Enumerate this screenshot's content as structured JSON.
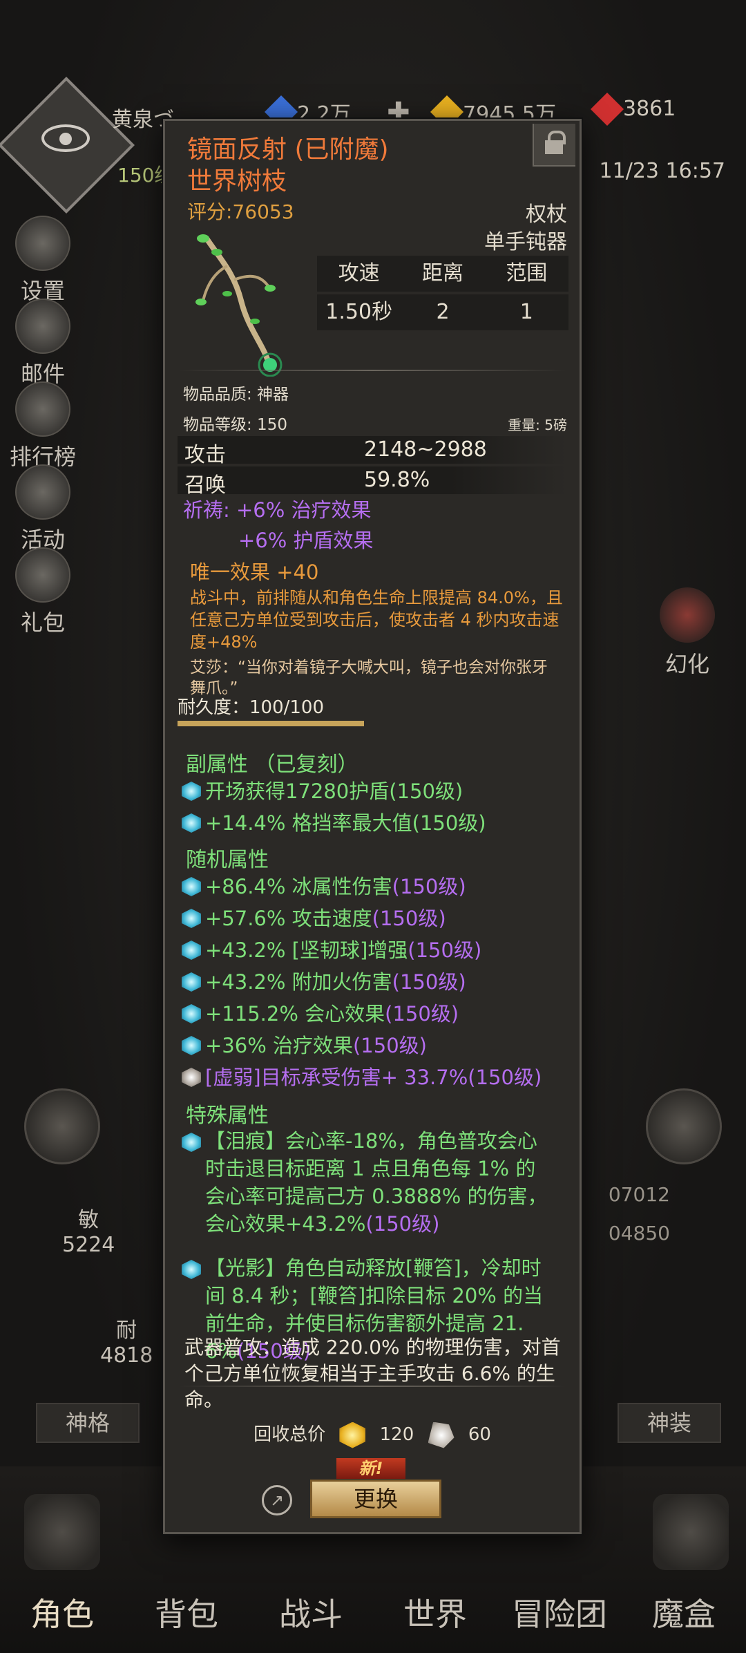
{
  "header": {
    "player_name": "黄泉づ",
    "player_level": "150级",
    "resources": [
      {
        "value": "2.2万",
        "icon": "blue-crystal-icon",
        "color": "#3a6fd8"
      },
      {
        "value": "7945.5万",
        "icon": "gold-crystal-icon",
        "color": "#e8b020"
      },
      {
        "value": "3861",
        "icon": "red-crystal-icon",
        "color": "#d03030"
      }
    ],
    "datetime": "11/23 16:57"
  },
  "sidebar": [
    {
      "label": "设置",
      "icon": "gear-icon"
    },
    {
      "label": "邮件",
      "icon": "mail-icon"
    },
    {
      "label": "排行榜",
      "icon": "ranking-icon"
    },
    {
      "label": "活动",
      "icon": "event-icon"
    },
    {
      "label": "礼包",
      "icon": "gift-icon"
    }
  ],
  "right_panel": {
    "transform_label": "幻化"
  },
  "char_stats": {
    "agi_label": "敏",
    "agi_value": "5224",
    "end_label": "耐",
    "end_value": "4818",
    "right_value_1": "07012",
    "right_value_2": "04850"
  },
  "bottom_chips": {
    "left": "神格",
    "right": "神装"
  },
  "item": {
    "name": "镜面反射 (已附魔)",
    "base_name": "世界树枝",
    "score": "评分:76053",
    "weapon_class": "权杖",
    "weapon_hand": "单手钝器",
    "stat_headers": [
      "攻速",
      "距离",
      "范围"
    ],
    "stat_values": [
      "1.50秒",
      "2",
      "1"
    ],
    "quality": "物品品质: 神器",
    "level": "物品等级: 150",
    "weight": "重量: 5磅",
    "attack_label": "攻击",
    "attack_value": "2148~2988",
    "summon_label": "召唤",
    "summon_value": "59.8%",
    "prayer_1": "祈祷: +6% 治疗效果",
    "prayer_2": "+6% 护盾效果",
    "unique_title": "唯一效果 +40",
    "unique_desc": "战斗中，前排随从和角色生命上限提高 84.0%，且任意己方单位受到攻击后，使攻击者 4 秒内攻击速度+48%",
    "quote": "艾莎：“当你对着镜子大喊大叫，镜子也会对你张牙舞爪。”",
    "durability": "耐久度：100/100",
    "durability_fraction": 1.0,
    "sub_title": "副属性 （已复刻）",
    "sub_attrs": [
      "开场获得17280护盾(150级)",
      "+14.4% 格挡率最大值(150级)"
    ],
    "random_title": "随机属性",
    "random_attrs": [
      {
        "text": "+86.4% 冰属性伤害",
        "lvl": "(150级)"
      },
      {
        "text": "+57.6% 攻击速度",
        "lvl": "(150级)"
      },
      {
        "text": "+43.2% [坚韧球]增强",
        "lvl": "(150级)"
      },
      {
        "text": "+43.2% 附加火伤害",
        "lvl": "(150级)"
      },
      {
        "text": "+115.2% 会心效果",
        "lvl": "(150级)"
      },
      {
        "text": "+36% 治疗效果",
        "lvl": "(150级)"
      },
      {
        "text": "[虚弱]目标承受伤害+ 33.7%",
        "lvl": "(150级)"
      }
    ],
    "special_title": "特殊属性",
    "special_1_line1": "【泪痕】会心率-18%，角色普攻会心",
    "special_1_line2": "时击退目标距离 1 点且角色每 1% 的",
    "special_1_line3": "会心率可提高己方 0.3888% 的伤害，",
    "special_1_line4": "会心效果+43.2%",
    "special_1_lvl": "(150级)",
    "special_2_line1": "【光影】角色自动释放[鞭笞]，冷却时",
    "special_2_line2": "间 8.4 秒；[鞭笞]扣除目标 20% 的当",
    "special_2_line3": "前生命，并使目标伤害额外提高 21.",
    "special_2_line4": "6%",
    "special_2_lvl": "(150级)",
    "normal_attack": "武器普攻：造成 220.0% 的物理伤害，对首个己方单位恢复相当于主手攻击 6.6% 的生命。",
    "recycle_label": "回收总价",
    "recycle_gold": "120",
    "recycle_silver": "60",
    "new_tag": "新!",
    "swap_label": "更换"
  },
  "nav": [
    {
      "label": "角色",
      "active": true
    },
    {
      "label": "背包",
      "active": false
    },
    {
      "label": "战斗",
      "active": false
    },
    {
      "label": "世界",
      "active": false
    },
    {
      "label": "冒险团",
      "active": false
    },
    {
      "label": "魔盒",
      "active": false
    }
  ]
}
